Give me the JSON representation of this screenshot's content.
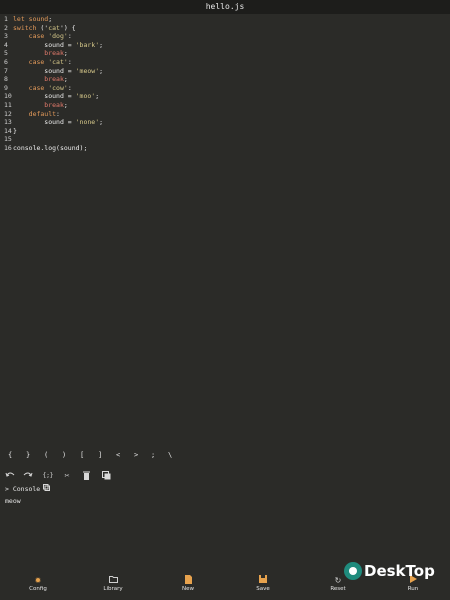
{
  "title": "hello.js",
  "lines": [
    {
      "n": "1",
      "segments": [
        {
          "t": "let ",
          "c": "kw"
        },
        {
          "t": "sound",
          "c": "kw"
        },
        {
          "t": ";",
          "c": "code"
        }
      ]
    },
    {
      "n": "2",
      "segments": [
        {
          "t": "switch",
          "c": "kw"
        },
        {
          "t": " ('",
          "c": "code"
        },
        {
          "t": "cat",
          "c": "str"
        },
        {
          "t": "') {",
          "c": "code"
        }
      ]
    },
    {
      "n": "3",
      "segments": [
        {
          "t": "    case ",
          "c": "kw"
        },
        {
          "t": "'dog'",
          "c": "str"
        },
        {
          "t": ":",
          "c": "code"
        }
      ]
    },
    {
      "n": "4",
      "segments": [
        {
          "t": "        sound = ",
          "c": "code"
        },
        {
          "t": "'bark'",
          "c": "str"
        },
        {
          "t": ";",
          "c": "code"
        }
      ]
    },
    {
      "n": "5",
      "segments": [
        {
          "t": "        break",
          "c": "br"
        },
        {
          "t": ";",
          "c": "code"
        }
      ]
    },
    {
      "n": "6",
      "segments": [
        {
          "t": "    case ",
          "c": "kw"
        },
        {
          "t": "'cat'",
          "c": "str"
        },
        {
          "t": ":",
          "c": "code"
        }
      ]
    },
    {
      "n": "7",
      "segments": [
        {
          "t": "        sound = ",
          "c": "code"
        },
        {
          "t": "'meow'",
          "c": "str"
        },
        {
          "t": ";",
          "c": "code"
        }
      ]
    },
    {
      "n": "8",
      "segments": [
        {
          "t": "        break",
          "c": "br"
        },
        {
          "t": ";",
          "c": "code"
        }
      ]
    },
    {
      "n": "9",
      "segments": [
        {
          "t": "    case ",
          "c": "kw"
        },
        {
          "t": "'cow'",
          "c": "str"
        },
        {
          "t": ":",
          "c": "code"
        }
      ]
    },
    {
      "n": "10",
      "segments": [
        {
          "t": "        sound = ",
          "c": "code"
        },
        {
          "t": "'moo'",
          "c": "str"
        },
        {
          "t": ";",
          "c": "code"
        }
      ]
    },
    {
      "n": "11",
      "segments": [
        {
          "t": "        break",
          "c": "br"
        },
        {
          "t": ";",
          "c": "code"
        }
      ]
    },
    {
      "n": "12",
      "segments": [
        {
          "t": "    default",
          "c": "kw"
        },
        {
          "t": ":",
          "c": "code"
        }
      ]
    },
    {
      "n": "13",
      "segments": [
        {
          "t": "        sound = ",
          "c": "code"
        },
        {
          "t": "'none'",
          "c": "str"
        },
        {
          "t": ";",
          "c": "code"
        }
      ]
    },
    {
      "n": "14",
      "segments": [
        {
          "t": "}",
          "c": "code"
        }
      ]
    },
    {
      "n": "15",
      "segments": []
    },
    {
      "n": "16",
      "segments": [
        {
          "t": "console.log(sound);",
          "c": "code"
        }
      ]
    }
  ],
  "symbols": [
    "{",
    "}",
    "(",
    ")",
    "[",
    "]",
    "<",
    ">",
    ";",
    "\\"
  ],
  "toolbar_icons": [
    "undo-icon",
    "redo-icon",
    "braces-icon",
    "scissors-icon",
    "trash-icon",
    "copy-icon"
  ],
  "console": {
    "label": "> Console",
    "output": "meow"
  },
  "bottom": {
    "config": "Config",
    "library": "Library",
    "new": "New",
    "save": "Save",
    "reset": "Reset",
    "run": "Run"
  },
  "watermark": "DeskTop",
  "colors": {
    "background": "#2b2b28",
    "accent": "#e7a24d",
    "keyword": "#e39a5a",
    "string": "#d7c98a"
  }
}
